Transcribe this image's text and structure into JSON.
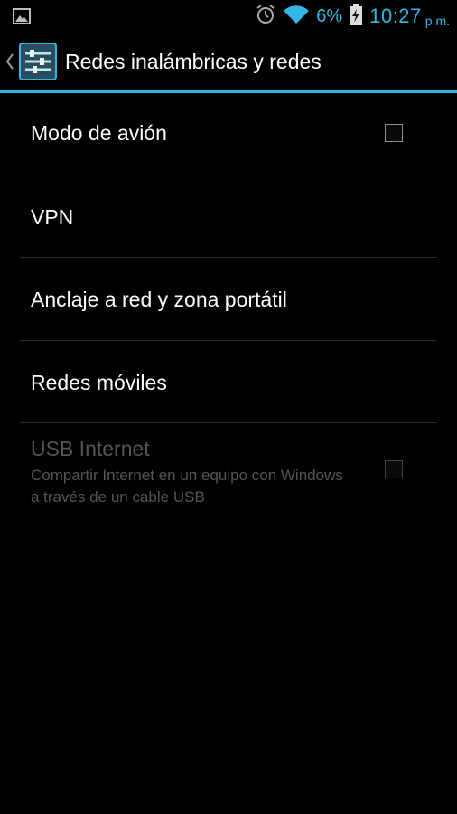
{
  "status_bar": {
    "notification_icon": "gallery-icon",
    "alarm_icon": "alarm-icon",
    "wifi_icon": "wifi-icon",
    "battery_icon": "battery-charging-icon",
    "battery_percent": "6%",
    "time": "10:27",
    "time_suffix": "p.m.",
    "accent_color": "#33b5e5"
  },
  "action_bar": {
    "up_icon": "back-caret-icon",
    "app_icon": "settings-sliders-icon",
    "title": "Redes inalámbricas y redes"
  },
  "settings": {
    "items": [
      {
        "title": "Modo de avión",
        "has_checkbox": true,
        "checked": false,
        "enabled": true
      },
      {
        "title": "VPN",
        "has_checkbox": false,
        "enabled": true
      },
      {
        "title": "Anclaje a red y zona portátil",
        "has_checkbox": false,
        "enabled": true
      },
      {
        "title": "Redes móviles",
        "has_checkbox": false,
        "enabled": true
      },
      {
        "title": "USB Internet",
        "summary": "Compartir Internet en un equipo con Windows a través de un cable USB",
        "has_checkbox": true,
        "checked": false,
        "enabled": false
      }
    ]
  }
}
